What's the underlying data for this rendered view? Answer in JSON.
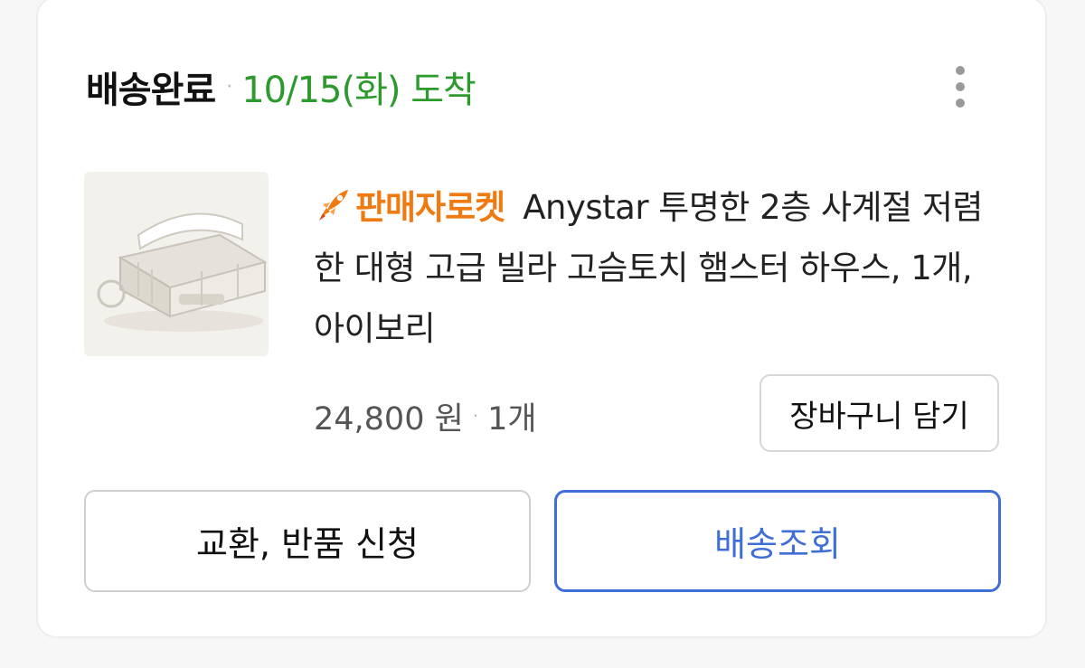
{
  "order": {
    "status": "배송완료",
    "separator": "·",
    "arrival": "10/15(화) 도착"
  },
  "product": {
    "badge": "판매자로켓",
    "title": "Anystar 투명한 2층 사계절 저렴한 대형 고급 빌라 고슴토치 햄스터 하우스, 1개, 아이보리",
    "price": "24,800 원",
    "quantity": "1개",
    "cart_label": "장바구니 담기"
  },
  "actions": {
    "exchange_label": "교환, 반품 신청",
    "track_label": "배송조회"
  },
  "icons": {
    "more": "more-vertical-icon",
    "badge": "rocket-icon"
  },
  "colors": {
    "arrival": "#2d9a2d",
    "badge": "#f07a12",
    "track": "#3f6fd6"
  }
}
